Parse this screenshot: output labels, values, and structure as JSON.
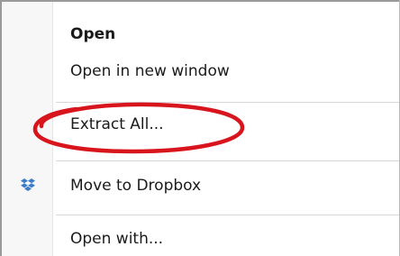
{
  "context_menu": {
    "items": [
      {
        "label": "Open",
        "bold": true,
        "icon": ""
      },
      {
        "label": "Open in new window",
        "bold": false,
        "icon": ""
      },
      {
        "label": "Extract All...",
        "bold": false,
        "icon": ""
      },
      {
        "label": "Move to Dropbox",
        "bold": false,
        "icon": "dropbox-icon"
      },
      {
        "label": "Open with...",
        "bold": false,
        "icon": ""
      }
    ]
  },
  "annotation": {
    "color": "#d8141c",
    "shape": "ellipse",
    "target": "Extract All..."
  },
  "colors": {
    "text": "#1a1a1a",
    "dropbox_blue": "#3d7cc9"
  }
}
